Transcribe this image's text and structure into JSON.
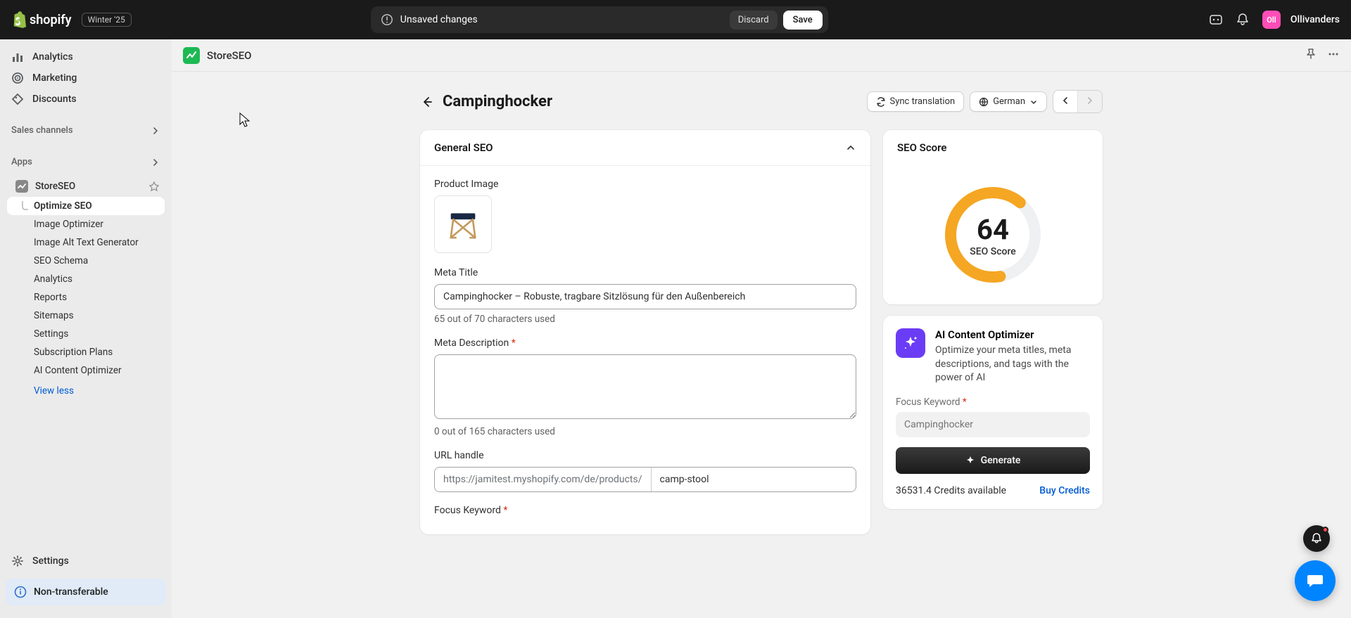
{
  "topbar": {
    "brand": "shopify",
    "badge": "Winter '25",
    "unsaved": "Unsaved changes",
    "discard": "Discard",
    "save": "Save",
    "avatar_initials": "Oll",
    "username": "Ollivanders"
  },
  "sidebar": {
    "primary": {
      "analytics": "Analytics",
      "marketing": "Marketing",
      "discounts": "Discounts"
    },
    "sales_channels": "Sales channels",
    "apps": "Apps",
    "app": {
      "name": "StoreSEO",
      "items": {
        "optimize": "Optimize SEO",
        "image_optimizer": "Image Optimizer",
        "alt_text": "Image Alt Text Generator",
        "schema": "SEO Schema",
        "analytics": "Analytics",
        "reports": "Reports",
        "sitemaps": "Sitemaps",
        "settings": "Settings",
        "subscription": "Subscription Plans",
        "ai_content": "AI Content Optimizer"
      },
      "view_less": "View less"
    },
    "settings": "Settings",
    "non_transferable": "Non-transferable"
  },
  "app_header": {
    "title": "StoreSEO"
  },
  "page": {
    "title": "Campinghocker",
    "sync": "Sync translation",
    "language": "German"
  },
  "general_seo": {
    "section_title": "General SEO",
    "product_image_label": "Product Image",
    "meta_title_label": "Meta Title",
    "meta_title_value": "Campinghocker – Robuste, tragbare Sitzlösung für den Außenbereich",
    "meta_title_help": "65 out of 70 characters used",
    "meta_desc_label": "Meta Description",
    "meta_desc_value": "",
    "meta_desc_help": "0 out of 165 characters used",
    "url_label": "URL handle",
    "url_prefix": "https://jamitest.myshopify.com/de/products/",
    "url_value": "camp-stool",
    "focus_keyword_label": "Focus Keyword"
  },
  "seo_score": {
    "title": "SEO Score",
    "value": "64",
    "label": "SEO Score"
  },
  "ai": {
    "title": "AI Content Optimizer",
    "desc": "Optimize your meta titles, meta descriptions, and tags with the power of AI",
    "focus_label": "Focus Keyword",
    "focus_placeholder": "Campinghocker",
    "generate": "Generate",
    "credits": "36531.4 Credits available",
    "buy": "Buy Credits"
  }
}
